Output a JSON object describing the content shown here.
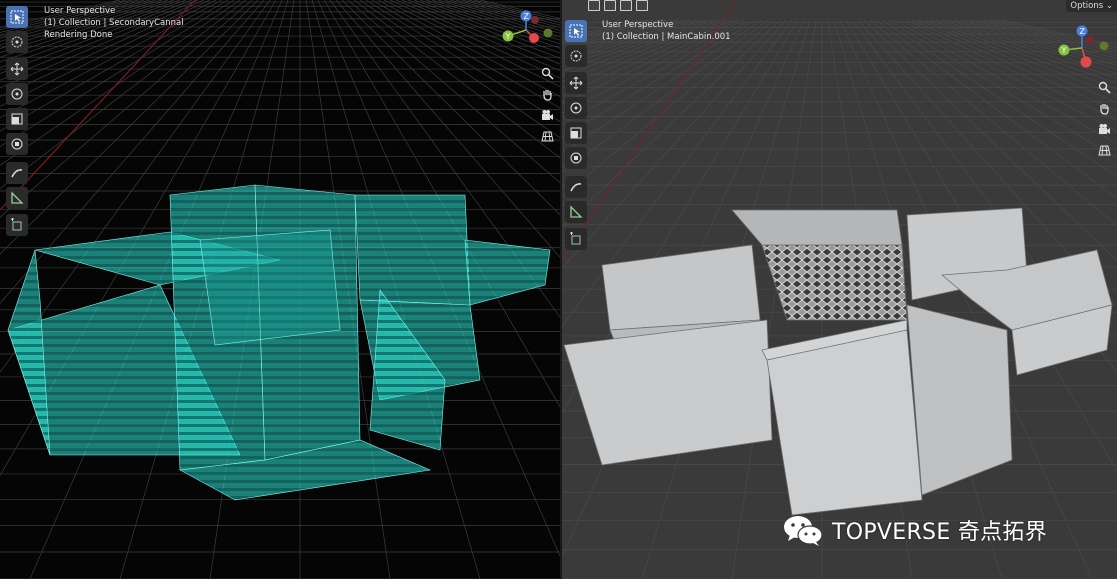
{
  "left_viewport": {
    "view_name": "User Perspective",
    "collection": "(1) Collection | SecondaryCannal",
    "status": "Rendering Done"
  },
  "right_viewport": {
    "view_name": "User Perspective",
    "collection": "(1) Collection | MainCabin.001",
    "options_label": "Options ⌄"
  },
  "gizmo": {
    "z_label": "Z",
    "y_label": "Y",
    "colors": {
      "x": "#e04a4a",
      "y": "#86c23d",
      "z": "#4a7fe0"
    }
  },
  "toolbar_icons": [
    "select-box-icon",
    "cursor-icon",
    "move-icon",
    "rotate-icon",
    "scale-icon",
    "transform-icon",
    "annotate-icon",
    "measure-icon",
    "add-cube-icon"
  ],
  "nav_icons": [
    "zoom-icon",
    "pan-hand-icon",
    "camera-icon",
    "grid-view-icon"
  ],
  "watermark": {
    "text": "TOPVERSE 奇点拓界",
    "icon": "wechat-icon"
  },
  "colors": {
    "wireframe_object": "#2ee6d6",
    "concrete": "#c9cbcc",
    "active_tool": "#4772b3"
  }
}
